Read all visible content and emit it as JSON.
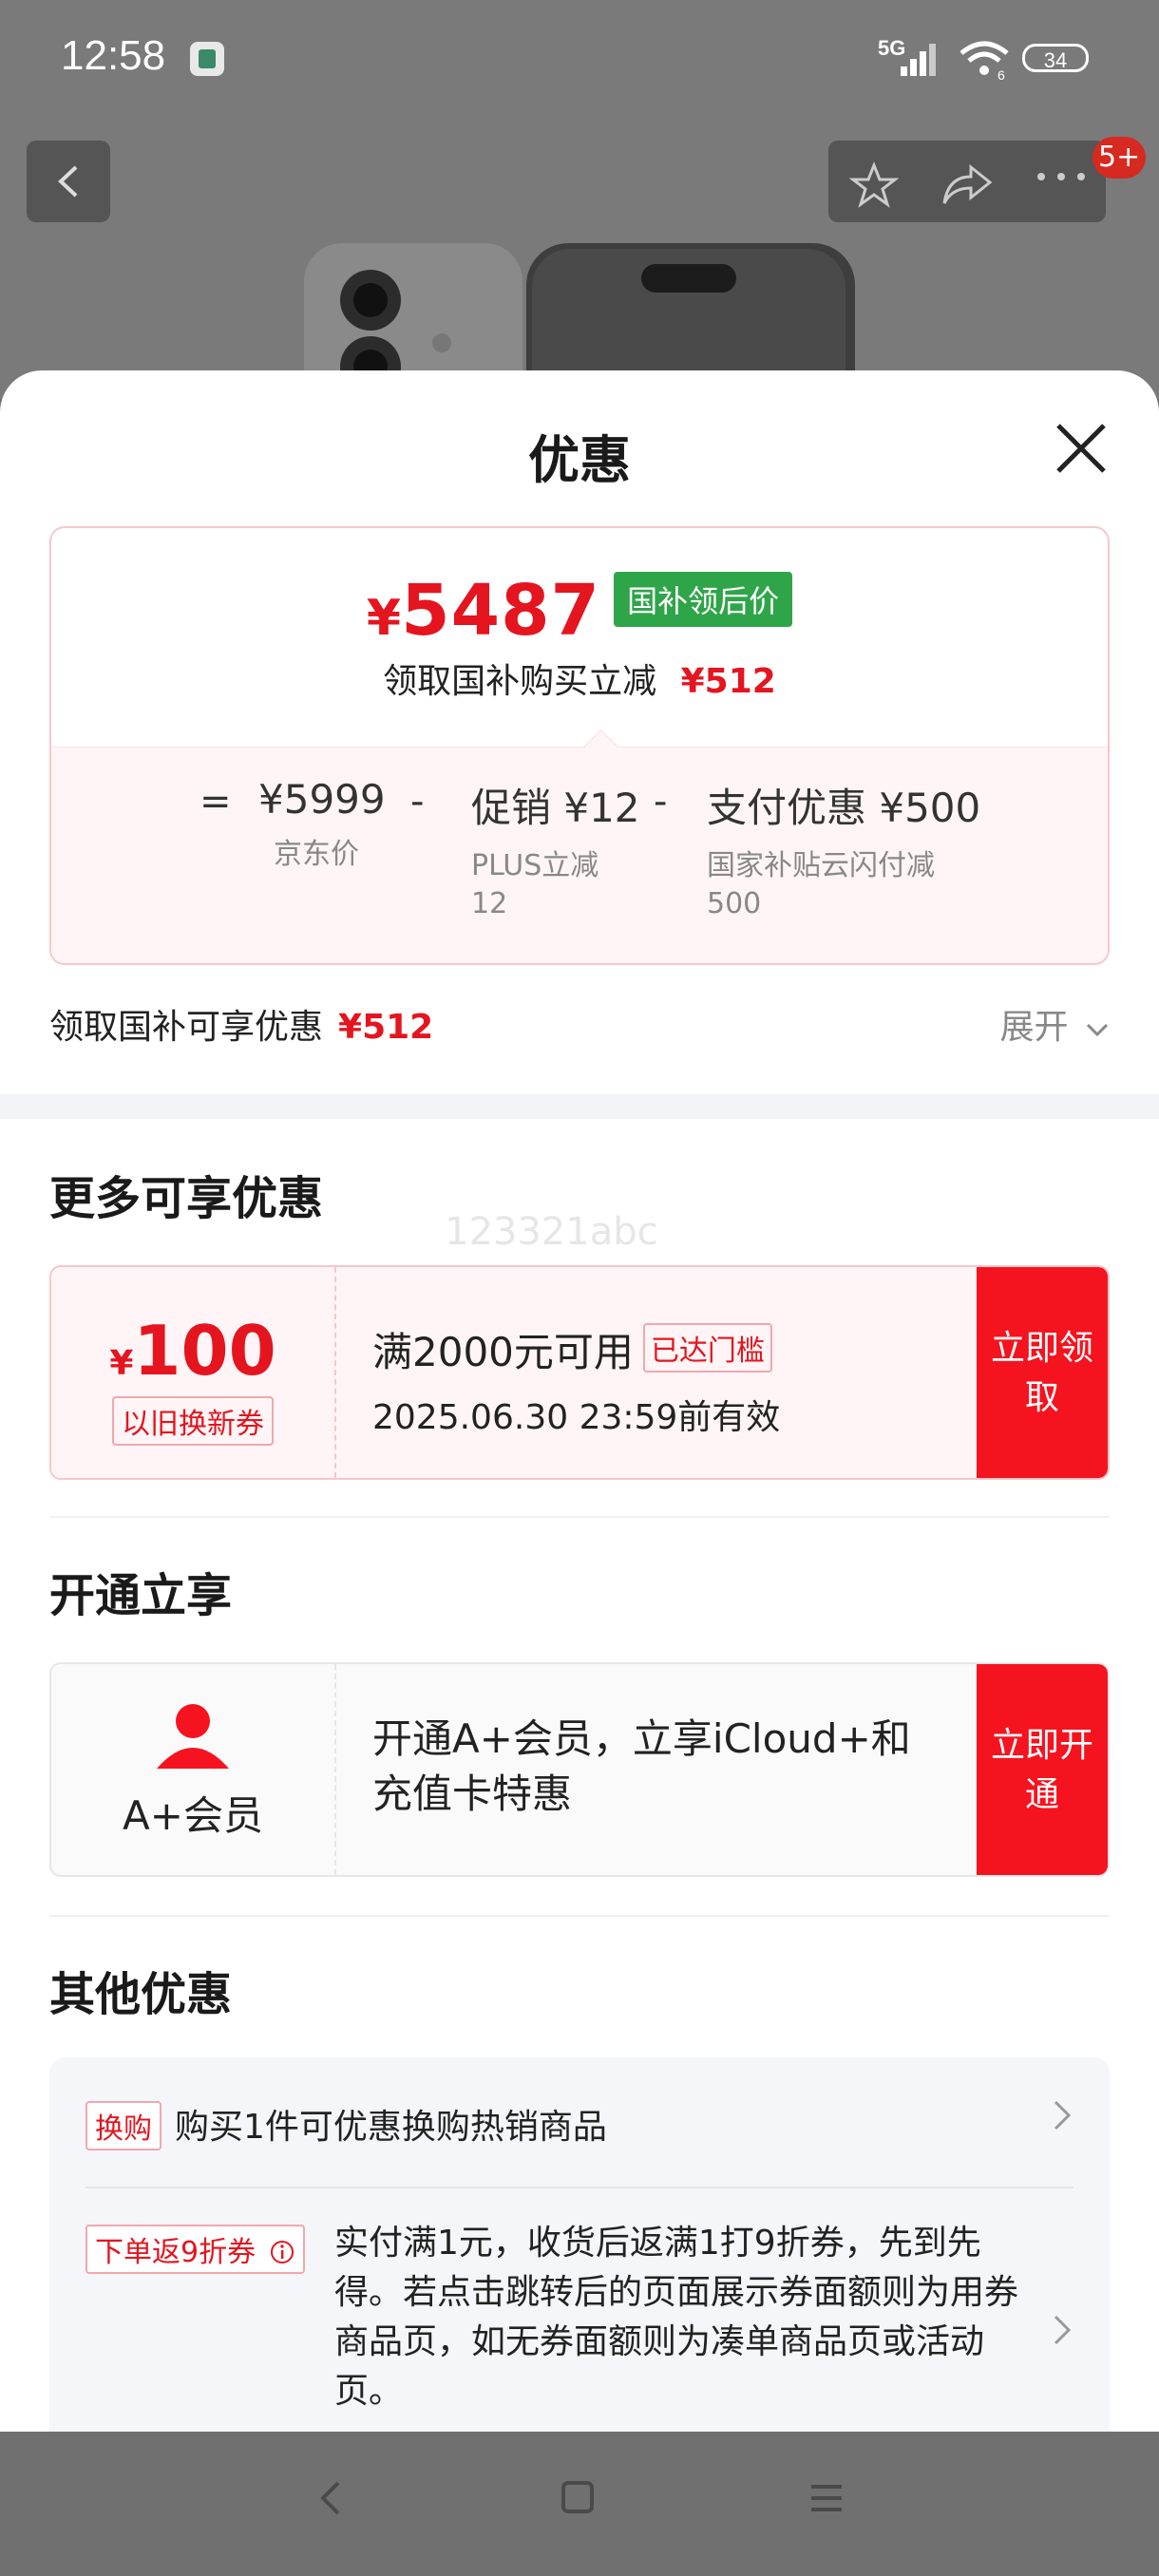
{
  "status_bar": {
    "time": "12:58",
    "network": "5G",
    "wifi_sub": "6",
    "battery": "34"
  },
  "header": {
    "badge": "5+"
  },
  "sheet": {
    "title": "优惠",
    "price": {
      "currency": "¥",
      "value": "5487",
      "tag": "国补领后价",
      "sub_text": "领取国补购买立减",
      "sub_amount": "¥512",
      "eq": "=",
      "items": [
        {
          "value": "¥5999",
          "desc": "京东价"
        },
        {
          "value": "促销 ¥12",
          "desc": "PLUS立减12"
        },
        {
          "value": "支付优惠 ¥500",
          "desc": "国家补贴云闪付减500"
        }
      ],
      "op": "-"
    },
    "claim": {
      "label": "领取国补可享优惠",
      "amount": "¥512",
      "expand": "展开"
    },
    "more_section": {
      "title": "更多可享优惠",
      "watermark": "123321abc",
      "coupon": {
        "currency": "¥",
        "amount": "100",
        "type": "以旧换新券",
        "condition": "满2000元可用",
        "reached": "已达门槛",
        "expiry": "2025.06.30 23:59前有效",
        "button": "立即领取"
      }
    },
    "vip_section": {
      "title": "开通立享",
      "name": "A+会员",
      "text": "开通A+会员，立享iCloud+和充值卡特惠",
      "button": "立即开通"
    },
    "other_section": {
      "title": "其他优惠",
      "items": [
        {
          "tag": "换购",
          "text": "购买1件可优惠换购热销商品"
        },
        {
          "tag": "下单返9折券",
          "text": "实付满1元，收货后返满1打9折券，先到先得。若点击跳转后的页面展示券面额则为用券商品页，如无券面额则为凑单商品页或活动页。"
        }
      ]
    }
  },
  "colors": {
    "accent": "#e4151f",
    "button": "#f5131f",
    "green_tag": "#2fa54a"
  }
}
